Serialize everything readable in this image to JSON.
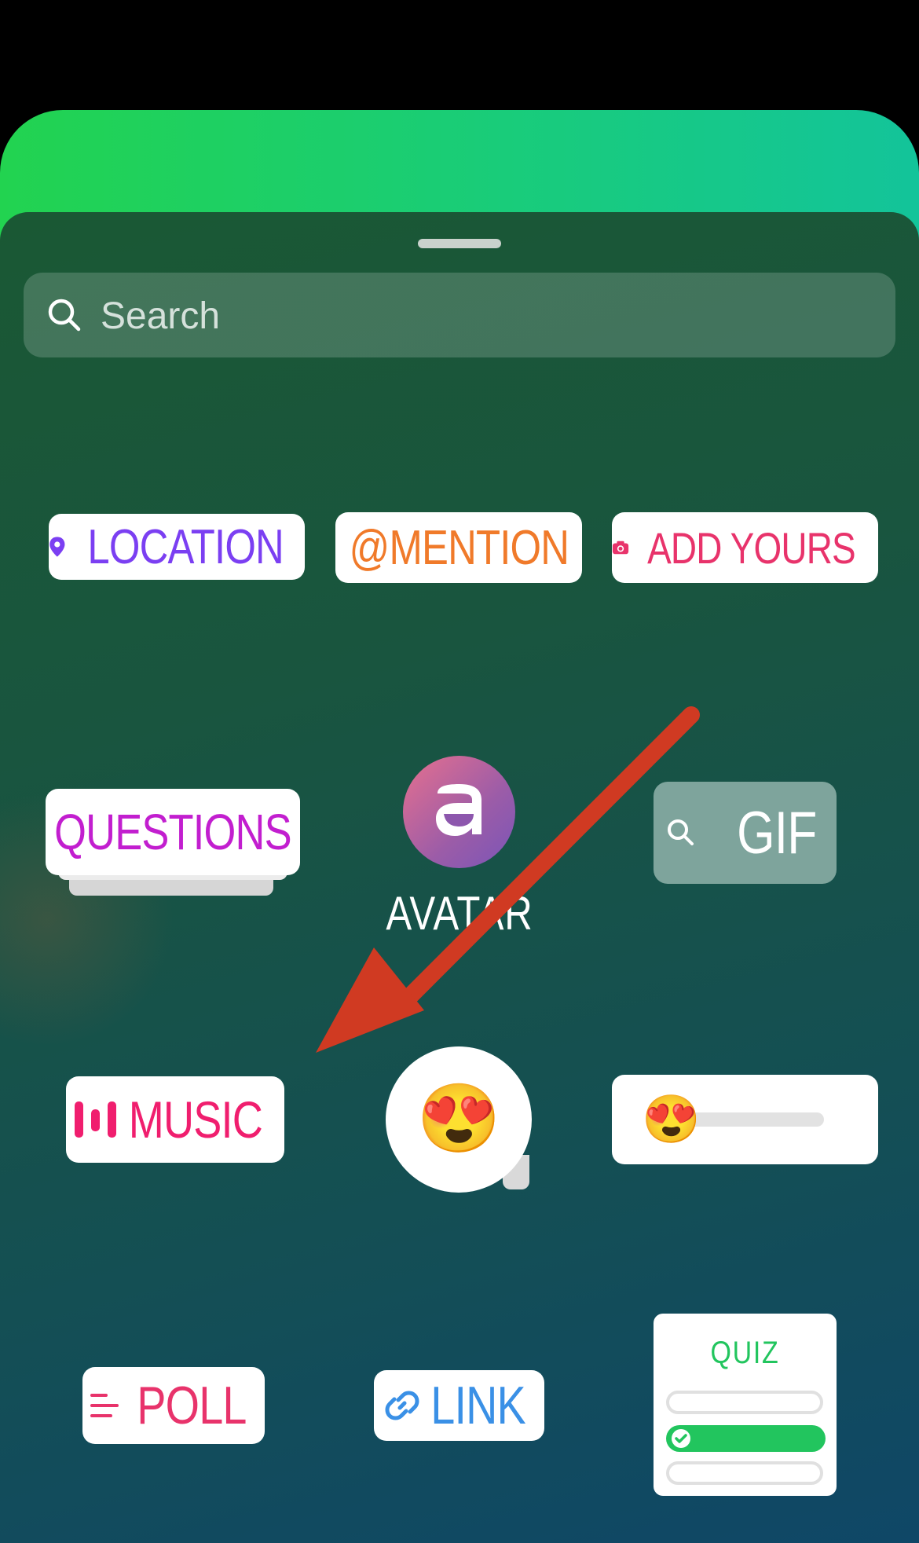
{
  "search": {
    "placeholder": "Search"
  },
  "stickers": {
    "location": "LOCATION",
    "mention": "@MENTION",
    "mention_text": "MENTION",
    "add_yours": "ADD YOURS",
    "questions": "QUESTIONS",
    "avatar": "AVATAR",
    "gif": "GIF",
    "music": "MUSIC",
    "poll": "POLL",
    "link": "LINK",
    "quiz": "QUIZ"
  },
  "emoji": {
    "reaction": "😍",
    "slider": "😍"
  },
  "colors": {
    "location": "#7b3ff2",
    "mention": "#f07a2a",
    "add_yours": "#e8336b",
    "questions": "#c21ecf",
    "music": "#f01e6e",
    "poll": "#e8336b",
    "link": "#3a90e6",
    "quiz": "#22c55e",
    "annotation_arrow": "#d03a22"
  }
}
